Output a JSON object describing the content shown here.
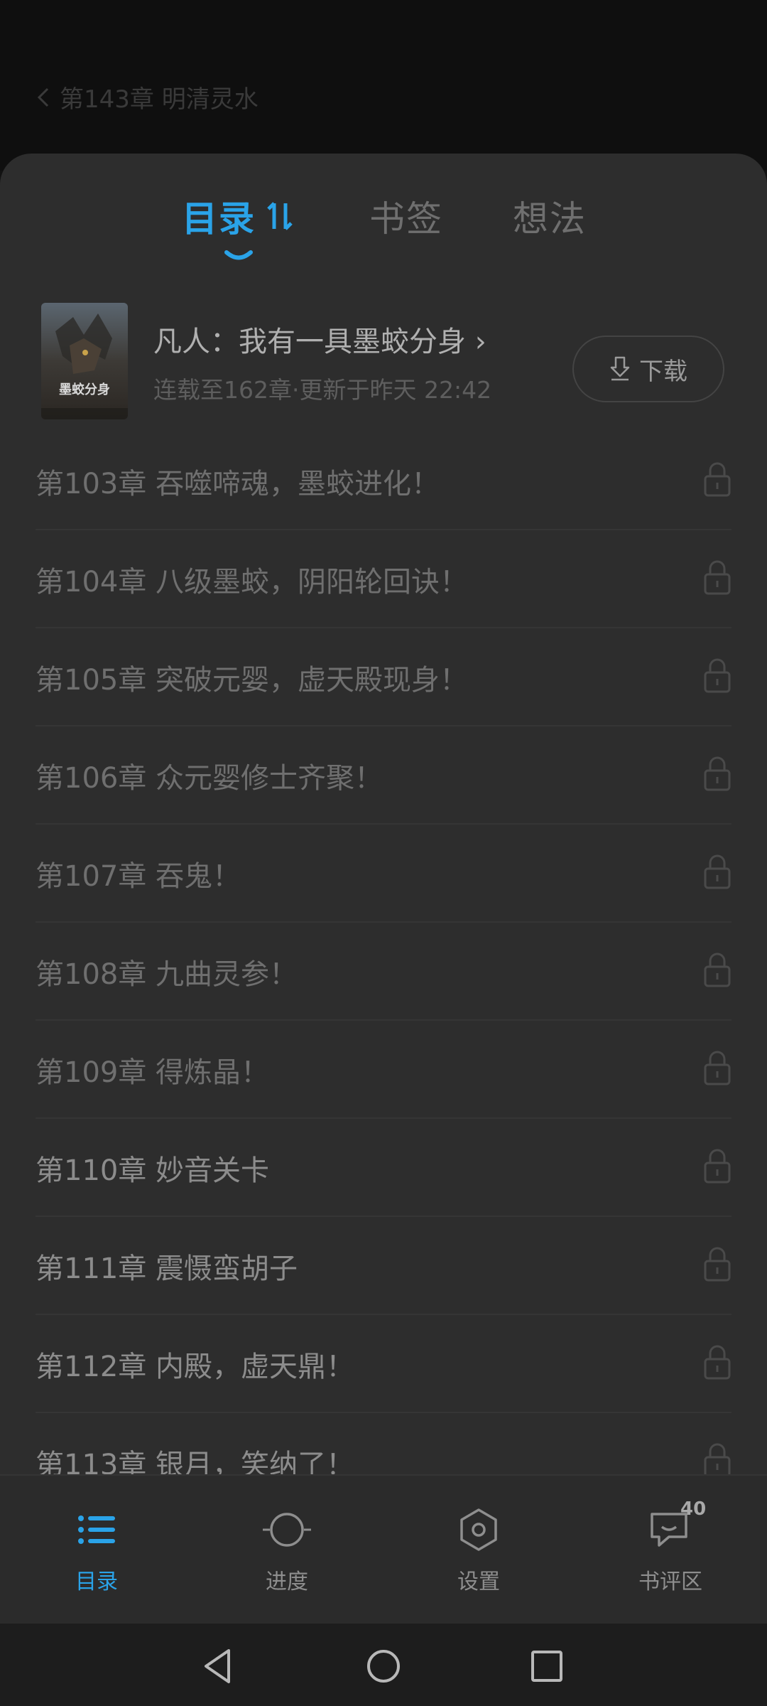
{
  "reader": {
    "chapter_title": "第143章 明清灵水"
  },
  "tabs": [
    {
      "label": "目录",
      "active": true
    },
    {
      "label": "书签",
      "active": false
    },
    {
      "label": "想法",
      "active": false
    }
  ],
  "book": {
    "title": "凡人：我有一具墨蛟分身 ›",
    "meta": "连载至162章·更新于昨天 22:42",
    "cover_text": "墨蛟分身",
    "download_label": "下载"
  },
  "chapters": [
    "第103章 吞噬啼魂，墨蛟进化！",
    "第104章 八级墨蛟，阴阳轮回诀！",
    "第105章 突破元婴，虚天殿现身！",
    "第106章 众元婴修士齐聚！",
    "第107章 吞鬼！",
    "第108章 九曲灵参！",
    "第109章 得炼晶！",
    "第110章 妙音关卡",
    "第111章 震慑蛮胡子",
    "第112章 内殿，虚天鼎！",
    "第113章 银月，笑纳了！"
  ],
  "bottom_menu": {
    "catalog": "目录",
    "progress": "进度",
    "settings": "设置",
    "reviews": "书评区",
    "reviews_badge": "40"
  },
  "colors": {
    "accent": "#2aa3e8",
    "sheet_bg": "#2d2d2d"
  }
}
